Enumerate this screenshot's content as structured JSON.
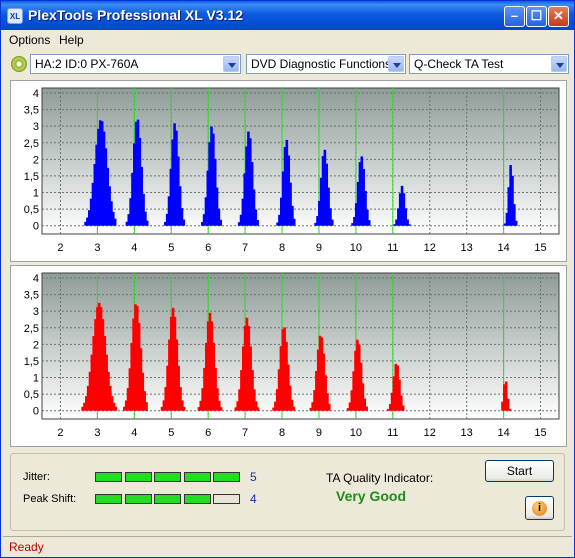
{
  "window": {
    "title": "PlexTools Professional XL V3.12",
    "icon_text": "XL"
  },
  "menu": {
    "items": [
      "Options",
      "Help"
    ]
  },
  "controls": {
    "drive": "HA:2 ID:0  PX-760A",
    "function": "DVD Diagnostic Functions",
    "test": "Q-Check TA Test"
  },
  "chart_data": [
    {
      "type": "bar",
      "name": "top-chart",
      "color": "#0000ff",
      "xlim": [
        1.5,
        15.5
      ],
      "ylim": [
        -0.25,
        4.15
      ],
      "x_ticks": [
        "2",
        "3",
        "4",
        "5",
        "6",
        "7",
        "8",
        "9",
        "10",
        "11",
        "12",
        "13",
        "14",
        "15"
      ],
      "y_ticks": [
        "0",
        "0,5",
        "1",
        "1,5",
        "2",
        "2,5",
        "3",
        "3,5",
        "4"
      ],
      "markers": [
        3,
        4,
        5,
        6,
        7,
        8,
        9,
        10,
        11,
        14
      ],
      "peaks": [
        {
          "center": 3.1,
          "height": 3.2,
          "width": 0.42
        },
        {
          "center": 4.08,
          "height": 3.25,
          "width": 0.28
        },
        {
          "center": 5.1,
          "height": 3.1,
          "width": 0.26
        },
        {
          "center": 6.1,
          "height": 3.0,
          "width": 0.26
        },
        {
          "center": 7.1,
          "height": 2.85,
          "width": 0.26
        },
        {
          "center": 8.12,
          "height": 2.6,
          "width": 0.24
        },
        {
          "center": 9.15,
          "height": 2.3,
          "width": 0.24
        },
        {
          "center": 10.15,
          "height": 2.1,
          "width": 0.24
        },
        {
          "center": 11.25,
          "height": 1.2,
          "width": 0.2
        },
        {
          "center": 14.2,
          "height": 1.85,
          "width": 0.16
        }
      ]
    },
    {
      "type": "bar",
      "name": "bottom-chart",
      "color": "#ff0000",
      "xlim": [
        1.5,
        15.5
      ],
      "ylim": [
        -0.25,
        4.15
      ],
      "x_ticks": [
        "2",
        "3",
        "4",
        "5",
        "6",
        "7",
        "8",
        "9",
        "10",
        "11",
        "12",
        "13",
        "14",
        "15"
      ],
      "y_ticks": [
        "0",
        "0,5",
        "1",
        "1,5",
        "2",
        "2,5",
        "3",
        "3,5",
        "4"
      ],
      "markers": [
        3,
        4,
        5,
        6,
        7,
        8,
        9,
        10,
        11,
        14
      ],
      "peaks": [
        {
          "center": 3.05,
          "height": 3.25,
          "width": 0.45
        },
        {
          "center": 4.05,
          "height": 3.25,
          "width": 0.32
        },
        {
          "center": 5.05,
          "height": 3.1,
          "width": 0.3
        },
        {
          "center": 6.05,
          "height": 2.95,
          "width": 0.3
        },
        {
          "center": 7.05,
          "height": 2.8,
          "width": 0.3
        },
        {
          "center": 8.05,
          "height": 2.55,
          "width": 0.28
        },
        {
          "center": 9.05,
          "height": 2.3,
          "width": 0.27
        },
        {
          "center": 10.05,
          "height": 2.15,
          "width": 0.26
        },
        {
          "center": 11.1,
          "height": 1.45,
          "width": 0.22
        },
        {
          "center": 14.05,
          "height": 0.95,
          "width": 0.13
        }
      ]
    }
  ],
  "quality": {
    "jitter_label": "Jitter:",
    "jitter_value": "5",
    "jitter_level": 5,
    "peak_shift_label": "Peak Shift:",
    "peak_shift_value": "4",
    "peak_shift_level": 4,
    "segments": 5,
    "indicator_label": "TA Quality Indicator:",
    "indicator_value": "Very Good",
    "start_label": "Start",
    "info_icon": "info-icon"
  },
  "status": {
    "text": "Ready"
  }
}
